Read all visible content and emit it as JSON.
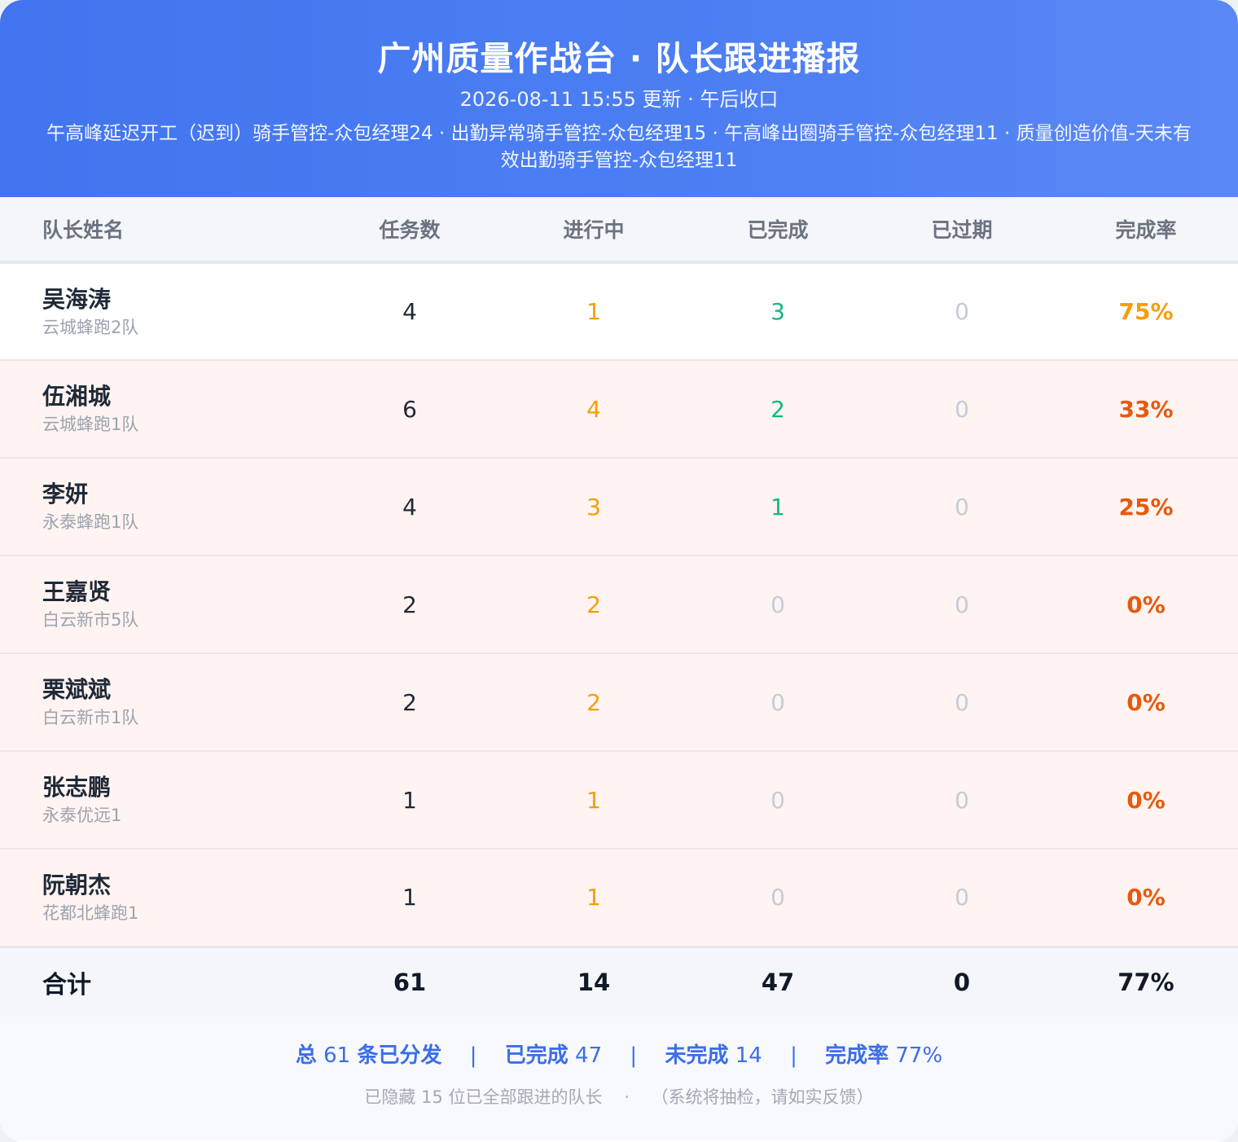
{
  "header": {
    "title": "广州质量作战台 · 队长跟进播报",
    "subtitle": "2026-08-11 15:55 更新 · 午后收口",
    "description": "午高峰延迟开工（迟到）骑手管控-众包经理24 · 出勤异常骑手管控-众包经理15 · 午高峰出圈骑手管控-众包经理11 · 质量创造价值-天未有效出勤骑手管控-众包经理11"
  },
  "columns": [
    "队长姓名",
    "任务数",
    "进行中",
    "已完成",
    "已过期",
    "完成率"
  ],
  "rows": [
    {
      "name": "吴海涛",
      "team": "云城蜂跑2队",
      "tasks": "4",
      "in_progress": "1",
      "done": "3",
      "expired": "0",
      "rate": "75%",
      "rate_color": "#f59e0b"
    },
    {
      "name": "伍湘城",
      "team": "云城蜂跑1队",
      "tasks": "6",
      "in_progress": "4",
      "done": "2",
      "expired": "0",
      "rate": "33%",
      "rate_color": "#e8590c"
    },
    {
      "name": "李妍",
      "team": "永泰蜂跑1队",
      "tasks": "4",
      "in_progress": "3",
      "done": "1",
      "expired": "0",
      "rate": "25%",
      "rate_color": "#e8590c"
    },
    {
      "name": "王嘉贤",
      "team": "白云新市5队",
      "tasks": "2",
      "in_progress": "2",
      "done": "0",
      "expired": "0",
      "rate": "0%",
      "rate_color": "#e8590c"
    },
    {
      "name": "栗斌斌",
      "team": "白云新市1队",
      "tasks": "2",
      "in_progress": "2",
      "done": "0",
      "expired": "0",
      "rate": "0%",
      "rate_color": "#e8590c"
    },
    {
      "name": "张志鹏",
      "team": "永泰优远1",
      "tasks": "1",
      "in_progress": "1",
      "done": "0",
      "expired": "0",
      "rate": "0%",
      "rate_color": "#e8590c"
    },
    {
      "name": "阮朝杰",
      "team": "花都北蜂跑1",
      "tasks": "1",
      "in_progress": "1",
      "done": "0",
      "expired": "0",
      "rate": "0%",
      "rate_color": "#e8590c"
    }
  ],
  "totals": {
    "label": "合计",
    "tasks": "61",
    "in_progress": "14",
    "done": "47",
    "expired": "0",
    "rate": "77%"
  },
  "summary": {
    "total_prefix": "总",
    "total_value": "61",
    "total_suffix": "条已分发",
    "done_label": "已完成",
    "done_value": "47",
    "undone_label": "未完成",
    "undone_value": "14",
    "rate_label": "完成率",
    "rate_value": "77%",
    "separator": "|"
  },
  "note": {
    "hidden_text": "已隐藏 15 位已全部跟进的队长",
    "dot": "·",
    "check_text": "（系统将抽检，请如实反馈）"
  },
  "colors": {
    "header_bg": "#4274ef",
    "in_progress": "#f59e0b",
    "done": "#10b981",
    "zero": "#c5ccd6",
    "alert_row_bg": "#fff4f2",
    "summary_text": "#3b6ee8"
  }
}
